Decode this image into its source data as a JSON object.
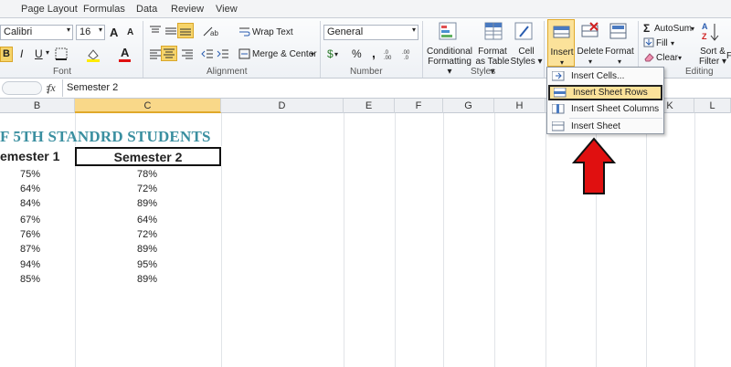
{
  "tabs": [
    "Page Layout",
    "Formulas",
    "Data",
    "Review",
    "View"
  ],
  "ribbon": {
    "font": {
      "name": "Calibri",
      "size": "16",
      "label": "Font",
      "bold": "B",
      "italic": "I",
      "underline": "U",
      "grow": "A",
      "shrink": "A",
      "color_letter": "A"
    },
    "alignment": {
      "label": "Alignment",
      "wrap_text": "Wrap Text",
      "merge_center": "Merge & Center"
    },
    "number": {
      "label": "Number",
      "format": "General",
      "currency": "$",
      "percent": "%",
      "comma": ","
    },
    "styles": {
      "label": "Styles",
      "conditional": [
        "Conditional",
        "Formatting"
      ],
      "format_table": [
        "Format",
        "as Table"
      ],
      "cell_styles": [
        "Cell",
        "Styles"
      ]
    },
    "cells": {
      "insert": "Insert",
      "delete": "Delete",
      "format": "Format"
    },
    "editing": {
      "label": "Editing",
      "autosum": "AutoSum",
      "fill": "Fill",
      "clear": "Clear",
      "sort": [
        "Sort &",
        "Filter"
      ],
      "find": "F"
    }
  },
  "formula_bar": {
    "fx": "fx",
    "value": "Semester 2"
  },
  "columns": [
    "B",
    "C",
    "D",
    "E",
    "F",
    "G",
    "H",
    "J",
    "K",
    "L"
  ],
  "sheet": {
    "title": "F 5TH STANDRD STUDENTS",
    "header_b": "emester 1",
    "header_c": "Semester 2",
    "rows": [
      {
        "b": "75%",
        "c": "78%"
      },
      {
        "b": "64%",
        "c": "72%"
      },
      {
        "b": "84%",
        "c": "89%"
      },
      {
        "b": "67%",
        "c": "64%"
      },
      {
        "b": "76%",
        "c": "72%"
      },
      {
        "b": "87%",
        "c": "89%"
      },
      {
        "b": "94%",
        "c": "95%"
      },
      {
        "b": "85%",
        "c": "89%"
      }
    ]
  },
  "insert_menu": [
    "Insert Cells...",
    "Insert Sheet Rows",
    "Insert Sheet Columns",
    "Insert Sheet"
  ],
  "colors": {
    "accent_orange": "#f6c34c",
    "title_teal": "#3a8fa0",
    "arrow_red": "#e01010"
  }
}
